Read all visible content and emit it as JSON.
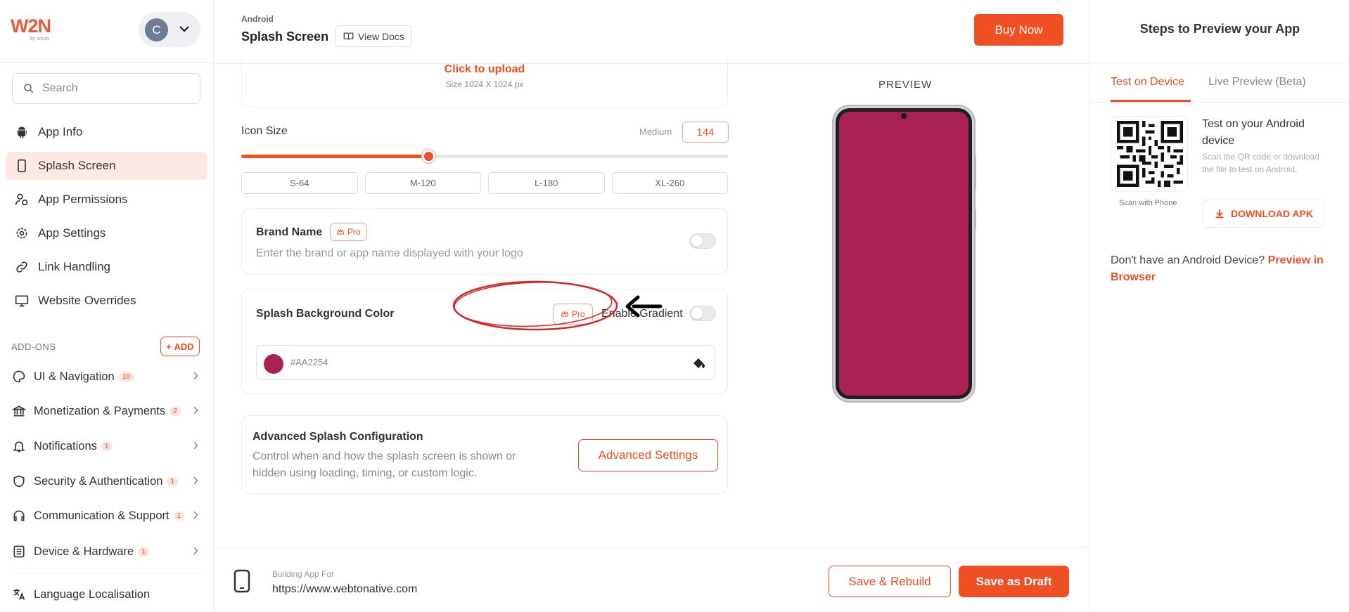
{
  "brand": {
    "logo_text": "W2N",
    "logo_sub": "by zoufa"
  },
  "user": {
    "initial": "C"
  },
  "search": {
    "placeholder": "Search"
  },
  "nav": [
    {
      "label": "App Info",
      "icon": "android-icon"
    },
    {
      "label": "Splash Screen",
      "icon": "phone-icon",
      "active": true
    },
    {
      "label": "App Permissions",
      "icon": "permissions-icon"
    },
    {
      "label": "App Settings",
      "icon": "gear-icon"
    },
    {
      "label": "Link Handling",
      "icon": "link-icon"
    },
    {
      "label": "Website Overrides",
      "icon": "monitor-icon"
    }
  ],
  "addons": {
    "heading": "ADD-ONS",
    "add_label": "ADD",
    "items": [
      {
        "label": "UI & Navigation",
        "badge": "10",
        "icon": "palette-icon"
      },
      {
        "label": "Monetization & Payments",
        "badge": "2",
        "icon": "bank-icon"
      },
      {
        "label": "Notifications",
        "badge": "1",
        "icon": "bell-icon"
      },
      {
        "label": "Security & Authentication",
        "badge": "1",
        "icon": "shield-icon"
      },
      {
        "label": "Communication & Support",
        "badge": "1",
        "icon": "headset-icon"
      },
      {
        "label": "Device & Hardware",
        "badge": "1",
        "icon": "hardware-icon"
      },
      {
        "label": "Language Localisation",
        "badge": "",
        "icon": "translate-icon"
      }
    ]
  },
  "header": {
    "platform": "Android",
    "title": "Splash Screen",
    "docs_label": "View Docs",
    "buy_label": "Buy Now"
  },
  "upload": {
    "cta": "Click to upload",
    "size": "Size 1024 X 1024 px"
  },
  "icon_size": {
    "label": "Icon Size",
    "level_label": "Medium",
    "value": "144",
    "slider_fraction": 0.385,
    "presets": [
      "S-64",
      "M-120",
      "L-180",
      "XL-260"
    ]
  },
  "brand_name": {
    "title": "Brand Name",
    "pro_label": "Pro",
    "placeholder": "Enter the brand or app name displayed with your logo"
  },
  "splash_bg": {
    "title": "Splash Background Color",
    "pro_label": "Pro",
    "gradient_label": "Enable Gradient",
    "color": "#AA2254",
    "color_display": "#AA2254"
  },
  "advanced": {
    "title": "Advanced Splash Configuration",
    "description": "Control when and how the splash screen is shown or hidden using loading, timing, or custom logic.",
    "button_label": "Advanced Settings"
  },
  "preview": {
    "label": "PREVIEW"
  },
  "footer": {
    "building_label": "Building App For",
    "url": "https://www.webtonative.com",
    "rebuild_label": "Save & Rebuild",
    "draft_label": "Save as Draft"
  },
  "right_panel": {
    "title": "Steps to Preview your App",
    "tabs": [
      "Test on Device",
      "Live Preview (Beta)"
    ],
    "test_title": "Test on your Android device",
    "test_desc": "Scan the QR code or download the file to test on Android.",
    "scan_label": "Scan with Phone",
    "download_label": "DOWNLOAD APK",
    "no_device_text": "Don't have an Android Device?",
    "preview_link": "Preview in Browser"
  },
  "colors": {
    "accent": "#F04E23",
    "active_bg": "#FDE9E4",
    "splash": "#AA2254"
  }
}
